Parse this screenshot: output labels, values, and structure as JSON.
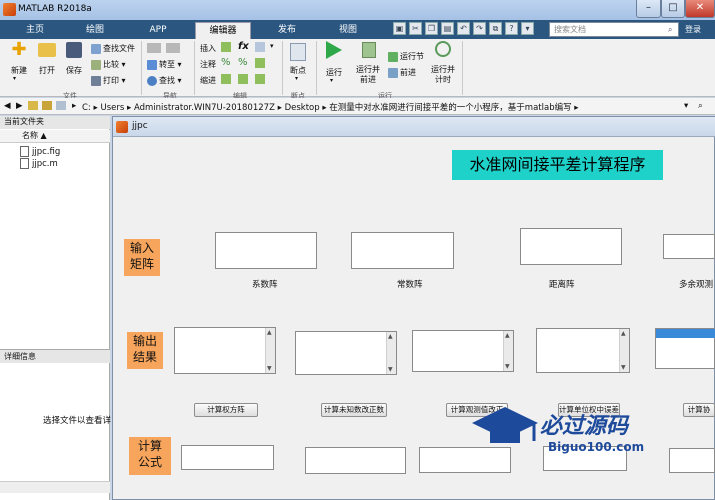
{
  "window": {
    "title": "MATLAB R2018a",
    "min": "–",
    "max": "□",
    "close": "✕"
  },
  "tabs": [
    {
      "label": "主页"
    },
    {
      "label": "绘图"
    },
    {
      "label": "APP"
    },
    {
      "label": "编辑器"
    },
    {
      "label": "发布"
    },
    {
      "label": "视图"
    }
  ],
  "search": {
    "placeholder": "搜索文档",
    "login": "登录"
  },
  "toolstrip": {
    "file": {
      "new": "新建",
      "open": "打开",
      "save": "保存",
      "find_files": "查找文件",
      "compare": "比较",
      "print": "打印",
      "group": "文件"
    },
    "navigate": {
      "goto": "转至",
      "find": "查找",
      "group": "导航"
    },
    "edit": {
      "insert": "插入",
      "comment": "注释",
      "indent": "缩进",
      "fx": "fx",
      "group": "编辑"
    },
    "breakpoints": {
      "label": "断点",
      "group": "断点"
    },
    "run": {
      "run": "运行",
      "run_advance": "运行并\n前进",
      "run_section": "运行节",
      "advance": "前进",
      "run_time": "运行并\n计时",
      "group": "运行"
    }
  },
  "address": {
    "parts": [
      "C:",
      "Users",
      "Administrator.WIN7U-20180127Z",
      "Desktop",
      "在测量中对水准网进行间接平差的一个小程序，基于matlab编写"
    ]
  },
  "current_folder": {
    "title": "当前文件夹",
    "column": "名称 ▲",
    "files": [
      "jjpc.fig",
      "jjpc.m"
    ],
    "details_title": "详细信息",
    "details_msg": "选择文件以查看详"
  },
  "figure": {
    "title": "jjpc",
    "main_title": "水准网间接平差计算程序",
    "input_label": "输入\n矩阵",
    "output_label": "输出\n结果",
    "formula_label": "计算\n公式",
    "captions": [
      "系数阵",
      "常数阵",
      "距离阵",
      "多余观测"
    ],
    "buttons": [
      "计算权方阵",
      "计算未知数改正数",
      "计算观测值改正",
      "计算单位权中误差",
      "计算协"
    ]
  },
  "watermark": {
    "name": "必过源码",
    "url": "Biguo100.com"
  }
}
